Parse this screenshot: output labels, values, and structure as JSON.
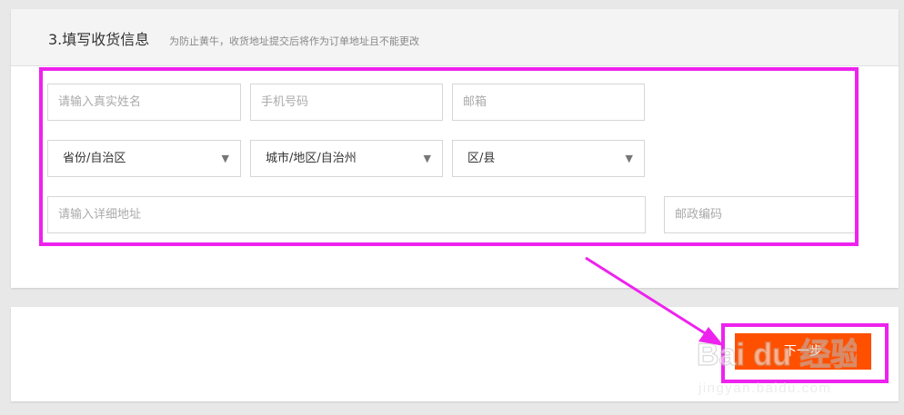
{
  "section": {
    "title": "3.填写收货信息",
    "note": "为防止黄牛，收货地址提交后将作为订单地址且不能更改"
  },
  "form": {
    "name_placeholder": "请输入真实姓名",
    "phone_placeholder": "手机号码",
    "email_placeholder": "邮箱",
    "province_select": "省份/自治区",
    "city_select": "城市/地区/自治州",
    "district_select": "区/县",
    "address_placeholder": "请输入详细地址",
    "postcode_placeholder": "邮政编码"
  },
  "submit": {
    "next_label": "下一步"
  },
  "annotation": {
    "color": "#ee22ee"
  },
  "theme": {
    "accent": "#ff5000"
  },
  "watermark": {
    "brand_text": "Bai du 经验",
    "url_text": "jingyan.baidu.com"
  }
}
